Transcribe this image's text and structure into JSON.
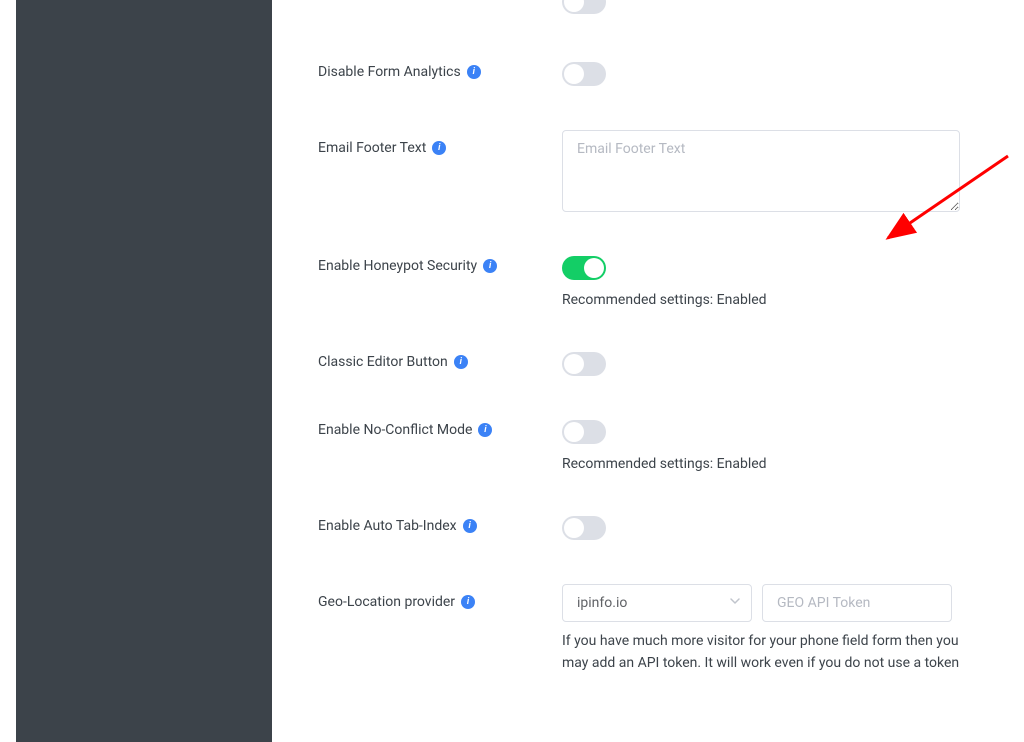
{
  "settings": {
    "disable_form_analytics": {
      "label": "Disable Form Analytics",
      "enabled": false
    },
    "email_footer_text": {
      "label": "Email Footer Text",
      "placeholder": "Email Footer Text",
      "value": ""
    },
    "enable_honeypot": {
      "label": "Enable Honeypot Security",
      "enabled": true,
      "helper": "Recommended settings: Enabled"
    },
    "classic_editor_button": {
      "label": "Classic Editor Button",
      "enabled": false
    },
    "enable_no_conflict": {
      "label": "Enable No-Conflict Mode",
      "enabled": false,
      "helper": "Recommended settings: Enabled"
    },
    "enable_auto_tab_index": {
      "label": "Enable Auto Tab-Index",
      "enabled": false
    },
    "geo_location": {
      "label": "Geo-Location provider",
      "selected": "ipinfo.io",
      "token_placeholder": "GEO API Token",
      "description": "If you have much more visitor for your phone field form then you may add an API token. It will work even if you do not use a token"
    }
  }
}
